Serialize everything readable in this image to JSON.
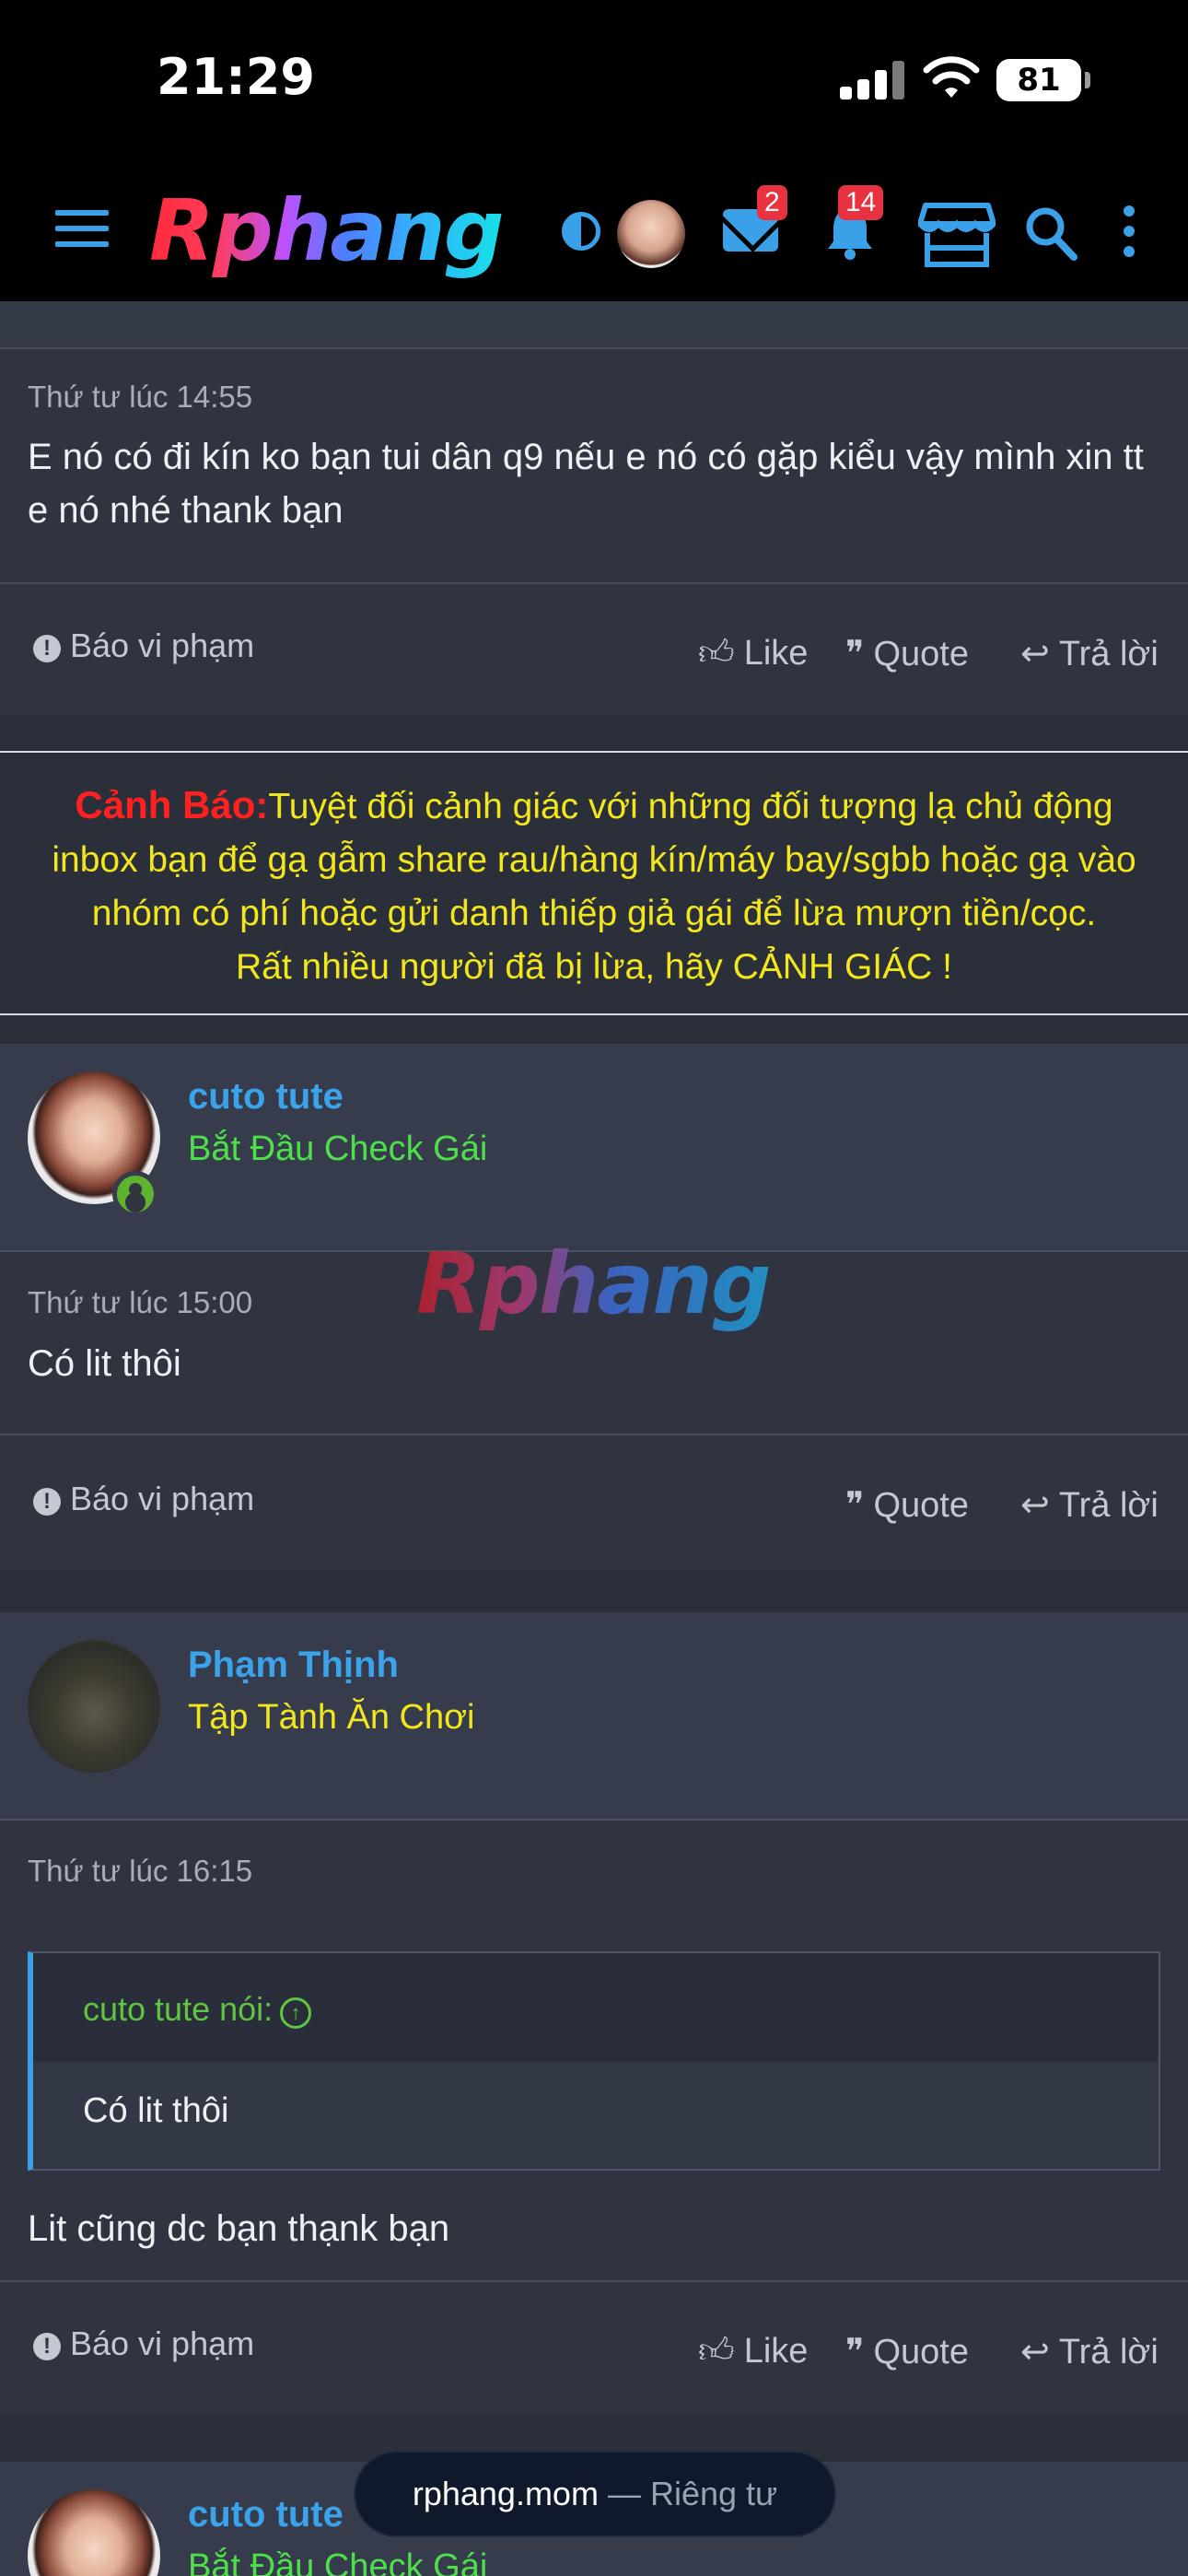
{
  "status_bar": {
    "time": "21:29",
    "battery": "81"
  },
  "header": {
    "logo": "Rphang",
    "mail_badge": "2",
    "notif_badge": "14"
  },
  "post1": {
    "date": "Thứ tư lúc 14:55",
    "body": "E nó có đi kín ko bạn tui dân q9 nếu e nó có gặp kiểu vậy mình xin tt e nó nhé thank bạn",
    "report": "Báo vi phạm",
    "like": "Like",
    "quote": "Quote",
    "reply": "Trả lời"
  },
  "warning": {
    "label": "Cảnh Báo:",
    "line1": "Tuyệt đối cảnh giác với những đối tượng lạ chủ động",
    "line2": "inbox bạn để gạ gẫm share rau/hàng kín/máy bay/sgbb hoặc gạ vào",
    "line3": "nhóm có phí hoặc gửi danh thiếp giả gái để lừa mượn tiền/cọc.",
    "line4": "Rất nhiều người đã bị lừa, hãy CẢNH GIÁC !"
  },
  "post2": {
    "username": "cuto tute",
    "usertitle": "Bắt Đầu Check Gái",
    "usertitle_color": "#4ee04a",
    "date": "Thứ tư lúc 15:00",
    "body": "Có lit thôi",
    "report": "Báo vi phạm",
    "quote": "Quote",
    "reply": "Trả lời"
  },
  "watermark": "Rphang",
  "post3": {
    "username": "Phạm Thịnh",
    "usertitle": "Tập Tành Ăn Chơi",
    "usertitle_color": "#f2e61c",
    "date": "Thứ tư lúc 16:15",
    "quote_author": "cuto tute nói:",
    "quote_text": "Có lit thôi",
    "body": "Lit cũng dc bạn thạnk bạn",
    "report": "Báo vi phạm",
    "like": "Like",
    "quote": "Quote",
    "reply": "Trả lời"
  },
  "post4": {
    "username": "cuto tute",
    "usertitle": "Bắt Đầu Check Gái"
  },
  "url_bar": {
    "domain": "rphang.mom",
    "separator": "—",
    "mode": "Riêng tư"
  }
}
